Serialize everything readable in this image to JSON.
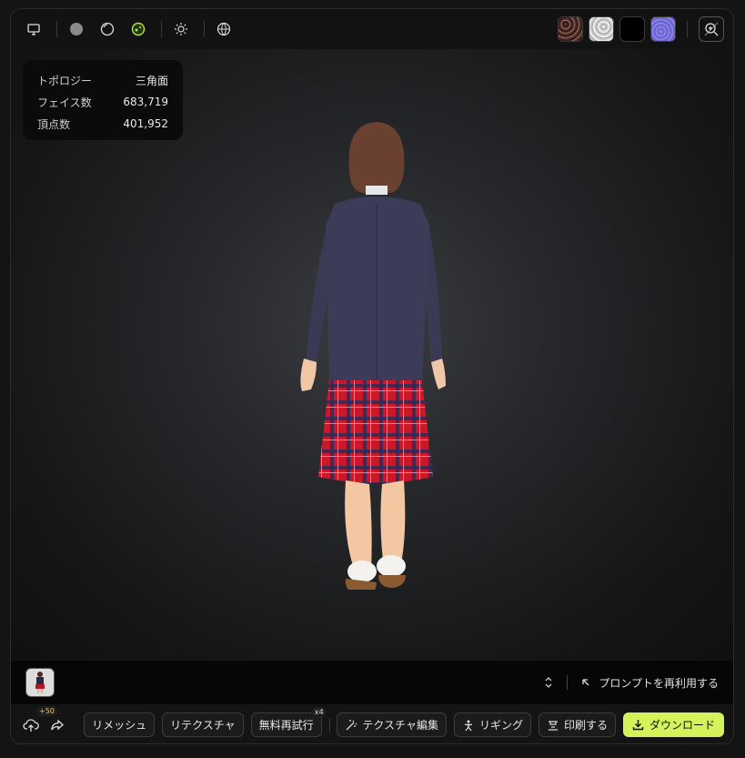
{
  "toolbar": {
    "left_icons": [
      "monitor-icon",
      "solid-sphere-icon",
      "wire-sphere-icon",
      "texture-sphere-icon",
      "sun-icon",
      "globe-icon"
    ],
    "swatches": [
      {
        "name": "albedo-map-swatch",
        "color": "#4a2a26"
      },
      {
        "name": "roughness-map-swatch",
        "color": "#d6d6d6"
      },
      {
        "name": "metallic-map-swatch",
        "color": "#000000"
      },
      {
        "name": "normal-map-swatch",
        "color": "#7a74d8"
      }
    ],
    "zoom_icon": "zoom-icon"
  },
  "stats": {
    "rows": [
      {
        "label": "トポロジー",
        "value": "三角面"
      },
      {
        "label": "フェイス数",
        "value": "683,719"
      },
      {
        "label": "頂点数",
        "value": "401,952"
      }
    ]
  },
  "strip": {
    "reuse_label": "プロンプトを再利用する"
  },
  "actions": {
    "upload_badge": "+50",
    "remesh": "リメッシュ",
    "retexture": "リテクスチャ",
    "free_retry": "無料再試行",
    "retry_badge": "x4",
    "texture_edit": "テクスチャ編集",
    "rigging": "リギング",
    "print": "印刷する",
    "download": "ダウンロード"
  },
  "colors": {
    "accent": "#d4f25a",
    "active_icon": "#b8e04a"
  }
}
